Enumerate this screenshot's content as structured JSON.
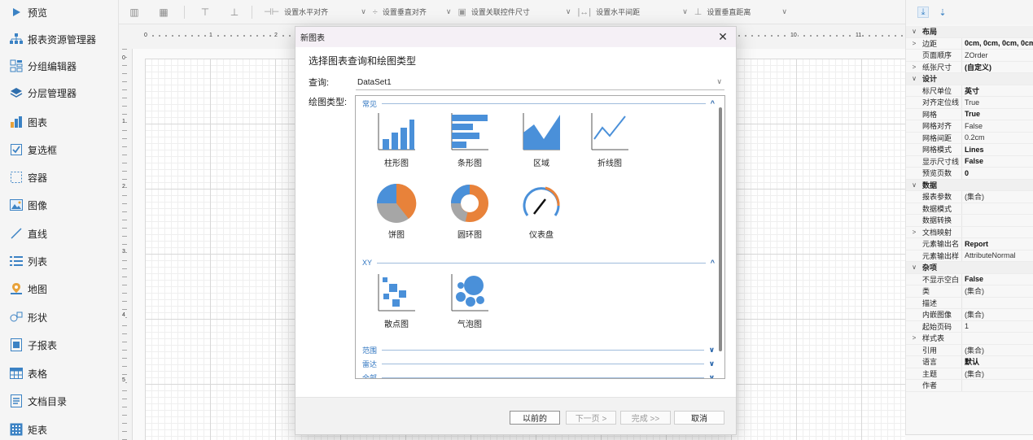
{
  "toolbox": {
    "items": [
      {
        "label": "预览",
        "icon": "play-icon"
      },
      {
        "label": "报表资源管理器",
        "icon": "tree-icon"
      },
      {
        "label": "分组编辑器",
        "icon": "group-icon"
      },
      {
        "label": "分层管理器",
        "icon": "layers-icon"
      },
      {
        "label": "图表",
        "icon": "chart-icon"
      },
      {
        "label": "复选框",
        "icon": "checkbox-icon"
      },
      {
        "label": "容器",
        "icon": "container-icon"
      },
      {
        "label": "图像",
        "icon": "image-icon"
      },
      {
        "label": "直线",
        "icon": "line-icon"
      },
      {
        "label": "列表",
        "icon": "list-icon"
      },
      {
        "label": "地图",
        "icon": "map-icon"
      },
      {
        "label": "形状",
        "icon": "shape-icon"
      },
      {
        "label": "子报表",
        "icon": "subreport-icon"
      },
      {
        "label": "表格",
        "icon": "table-icon"
      },
      {
        "label": "文档目录",
        "icon": "toc-icon"
      },
      {
        "label": "矩表",
        "icon": "matrix-icon"
      }
    ]
  },
  "toolbar": {
    "h_align": "设置水平对齐",
    "v_align": "设置垂直对齐",
    "control_size": "设置关联控件尺寸",
    "h_spacing": "设置水平间距",
    "v_spacing": "设置垂直距离"
  },
  "ruler": {
    "top": [
      "0",
      "1",
      "2",
      "10",
      "11"
    ],
    "left": [
      "0",
      "1",
      "2",
      "3",
      "4",
      "5"
    ]
  },
  "properties": {
    "rows": [
      {
        "expander": "∨",
        "name": "布局",
        "value": "",
        "category": true
      },
      {
        "expander": ">",
        "name": "边距",
        "value": "0cm, 0cm, 0cm, 0cm",
        "bold": true
      },
      {
        "expander": "",
        "name": "页面顺序",
        "value": "ZOrder"
      },
      {
        "expander": ">",
        "name": "纸张尺寸",
        "value": "(自定义)",
        "bold": true
      },
      {
        "expander": "∨",
        "name": "设计",
        "value": "",
        "category": true
      },
      {
        "expander": "",
        "name": "标尺单位",
        "value": "英寸",
        "bold": true
      },
      {
        "expander": "",
        "name": "对齐定位线",
        "value": "True"
      },
      {
        "expander": "",
        "name": "网格",
        "value": "True",
        "bold": true
      },
      {
        "expander": "",
        "name": "网格对齐",
        "value": "False"
      },
      {
        "expander": "",
        "name": "网格间距",
        "value": "0.2cm"
      },
      {
        "expander": "",
        "name": "网格模式",
        "value": "Lines",
        "bold": true
      },
      {
        "expander": "",
        "name": "显示尺寸线",
        "value": "False",
        "bold": true
      },
      {
        "expander": "",
        "name": "预览页数",
        "value": "0",
        "bold": true
      },
      {
        "expander": "∨",
        "name": "数据",
        "value": "",
        "category": true
      },
      {
        "expander": "",
        "name": "报表参数",
        "value": "(集合)"
      },
      {
        "expander": "",
        "name": "数据模式",
        "value": ""
      },
      {
        "expander": "",
        "name": "数据转换",
        "value": ""
      },
      {
        "expander": ">",
        "name": "文档映射",
        "value": ""
      },
      {
        "expander": "",
        "name": "元素输出名",
        "value": "Report",
        "bold": true
      },
      {
        "expander": "",
        "name": "元素输出样",
        "value": "AttributeNormal"
      },
      {
        "expander": "∨",
        "name": "杂项",
        "value": "",
        "category": true
      },
      {
        "expander": "",
        "name": "不显示空白",
        "value": "False",
        "bold": true
      },
      {
        "expander": "",
        "name": "类",
        "value": "(集合)"
      },
      {
        "expander": "",
        "name": "描述",
        "value": ""
      },
      {
        "expander": "",
        "name": "内嵌图像",
        "value": "(集合)"
      },
      {
        "expander": "",
        "name": "起始页码",
        "value": "1"
      },
      {
        "expander": ">",
        "name": "样式表",
        "value": ""
      },
      {
        "expander": "",
        "name": "引用",
        "value": "(集合)"
      },
      {
        "expander": "",
        "name": "语言",
        "value": "默认",
        "bold": true
      },
      {
        "expander": "",
        "name": "主题",
        "value": "(集合)"
      },
      {
        "expander": "",
        "name": "作者",
        "value": ""
      }
    ]
  },
  "dialog": {
    "title": "新图表",
    "heading": "选择图表查询和绘图类型",
    "query_label": "查询:",
    "query_value": "DataSet1",
    "charttype_label": "绘图类型:",
    "sections": {
      "common": "常见",
      "xy": "XY",
      "range": "范围",
      "radar": "雷达",
      "all": "全部"
    },
    "tiles": {
      "column": "柱形图",
      "bar": "条形图",
      "area": "区域",
      "line": "折线图",
      "pie": "饼图",
      "donut": "圆环图",
      "gauge": "仪表盘",
      "scatter": "散点图",
      "bubble": "气泡图"
    },
    "buttons": {
      "back": "以前的",
      "next": "下一页 >",
      "finish": "完成 >>",
      "cancel": "取消"
    }
  },
  "colors": {
    "accent": "#3b82c4",
    "chart_blue": "#4a90d9",
    "chart_orange": "#e8823a",
    "chart_gray": "#a6a6a6"
  }
}
